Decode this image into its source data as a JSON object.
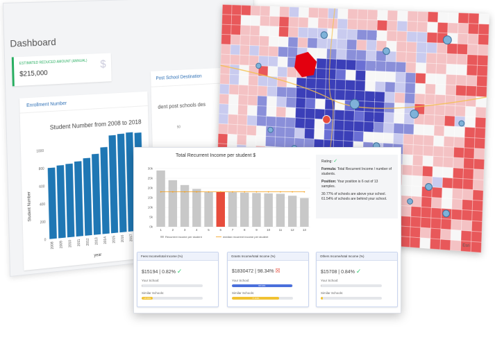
{
  "dashboard": {
    "title": "Dashboard",
    "kpi": {
      "label": "ESTIMATED REDUCED AMOUNT (ANNUAL)",
      "value": "$215,000",
      "icon": "dollar-icon"
    },
    "enrollment": {
      "header": "Enrollment Number",
      "chart_title": "Student Number from 2008 to 2018",
      "ylabel": "Student Number",
      "xlabel": "year",
      "yticks": [
        "1000",
        "800",
        "600",
        "400",
        "200",
        "0"
      ]
    },
    "post_school": {
      "header": "Post School Destination",
      "subtitle": "dent post schools des",
      "tick": "50"
    }
  },
  "chart_data": [
    {
      "type": "bar",
      "title": "Student Number from 2008 to 2018",
      "ylabel": "Student Number",
      "xlabel": "year",
      "categories": [
        "2008",
        "2009",
        "2010",
        "2011",
        "2012",
        "2013",
        "2014",
        "2015",
        "2016",
        "2017",
        "2018"
      ],
      "values": [
        800,
        820,
        830,
        850,
        880,
        920,
        990,
        1120,
        1130,
        1140,
        1130
      ],
      "ylim": [
        0,
        1000
      ]
    },
    {
      "type": "bar",
      "title": "Total Recurrent Income per student $",
      "categories": [
        "1",
        "2",
        "3",
        "4",
        "5",
        "6",
        "7",
        "8",
        "9",
        "10",
        "11",
        "12",
        "13"
      ],
      "values": [
        29000,
        24000,
        21500,
        19500,
        18000,
        18000,
        17800,
        17600,
        17400,
        17200,
        17000,
        16000,
        14800
      ],
      "highlight_index": 5,
      "median": 18000,
      "yticks": [
        "30k",
        "25k",
        "20k",
        "15k",
        "10k",
        "5k",
        "0k"
      ],
      "ylim": [
        0,
        30000
      ],
      "legend": [
        "Recurrent income per student",
        "median recurrent income per student"
      ],
      "colors": {
        "bar": "#c8c8c8",
        "highlight": "#e74c3c",
        "median": "#f39c12"
      }
    }
  ],
  "rating": {
    "label": "Rating:",
    "formula_label": "Formula:",
    "formula": "Total Recurrent Income / number of students.",
    "position_label": "Position:",
    "position": "Your position is 6 out of 13 samples.",
    "above": "30.77% of schools are above your school.",
    "behind": "61.54% of schools are behind your school."
  },
  "metrics": [
    {
      "title": "Fees Income/total Income (%)",
      "value": "$15194 | 0.82%",
      "status": "ok",
      "your_label": "Your School:",
      "your_fraction": 0.0082,
      "your_text": "",
      "similar_label": "Similar Schools:",
      "similar_fraction": 0.1853,
      "similar_text": "18.53%",
      "similar_color": "yellow"
    },
    {
      "title": "Grants Income/total Income (%)",
      "value": "$1830472 | 98.34%",
      "status": "bad",
      "your_label": "Your School:",
      "your_fraction": 0.9834,
      "your_text": "98.34%",
      "similar_label": "Similar Schools:",
      "similar_fraction": 0.7784,
      "similar_text": "77.84%",
      "similar_color": "yellow"
    },
    {
      "title": "Others Income/total Income (%)",
      "value": "$15708 | 0.84%",
      "status": "ok",
      "your_label": "Your School:",
      "your_fraction": 0.0084,
      "your_text": "",
      "similar_label": "Similar Schools:",
      "similar_fraction": 0.036,
      "similar_text": "",
      "similar_color": "yellow"
    }
  ],
  "map": {
    "attribution": "Esri",
    "colors": {
      "high": "#e8585a",
      "mid": "#f4c2c4",
      "low": "#3b3fb8",
      "neutral": "#f7f7f7"
    }
  }
}
